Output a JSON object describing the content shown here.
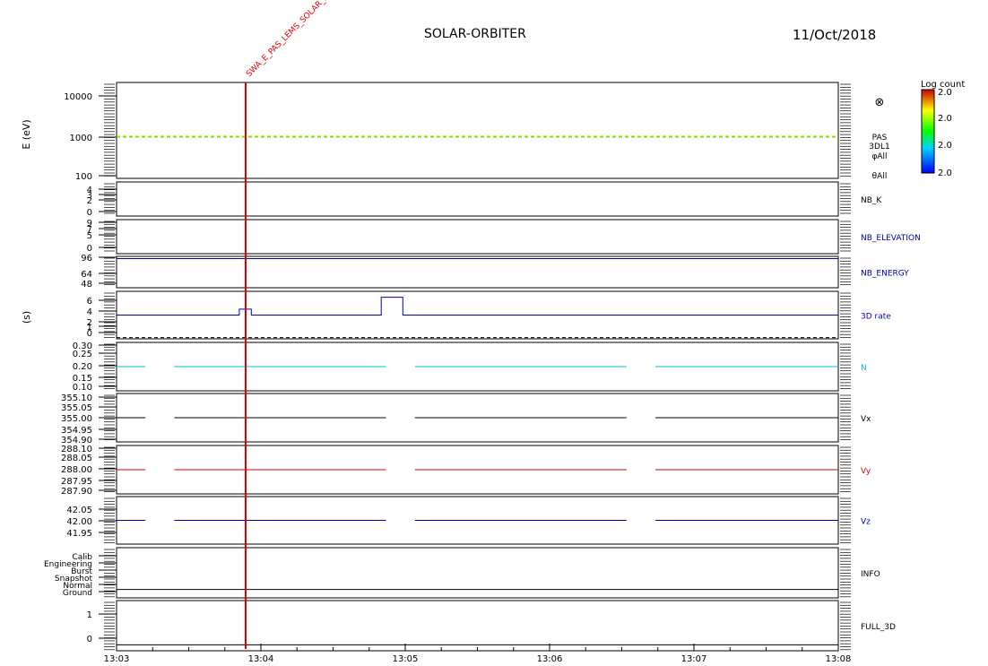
{
  "header": {
    "mission": "SOLAR-ORBITER",
    "date": "11/Oct/2018"
  },
  "marker": {
    "label": "SWA_E_PAS_LEMS_SOLAR_SOI",
    "time": "13:03:53",
    "color": "#e00000"
  },
  "colorbar": {
    "title": "Log count",
    "ticks": [
      "2.0",
      "2.0",
      "2.0",
      "2.0"
    ]
  },
  "side_labels": {
    "energy": "E (eV)",
    "seconds": "(s)"
  },
  "chart_data": {
    "type": "line",
    "x_range": [
      "13:03",
      "13:08"
    ],
    "x_ticks": [
      "13:03",
      "13:04",
      "13:05",
      "13:06",
      "13:07",
      "13:08"
    ],
    "panels": [
      {
        "id": "spectrogram",
        "title_lines": [
          "PAS",
          "3DL1",
          "φAll",
          "",
          "θAll"
        ],
        "symbol": "⊗",
        "ylog": true,
        "ylim": [
          100,
          20000
        ],
        "y_ticks": [
          "10000",
          "1000",
          "100"
        ],
        "series": [
          {
            "style": "dashed",
            "color": "#88dd00",
            "segments": [
              [
                0,
                300,
                1000
              ]
            ]
          }
        ]
      },
      {
        "id": "nb_k",
        "label": "NB_K",
        "label_color": "#000000",
        "ylim": [
          0,
          5
        ],
        "y_ticks": [
          "4",
          "3",
          "2",
          "0"
        ],
        "series": []
      },
      {
        "id": "nb_elevation",
        "label": "NB_ELEVATION",
        "label_color": "#0000aa",
        "ylim": [
          0,
          10
        ],
        "y_ticks": [
          "9",
          "7",
          "5",
          "0"
        ],
        "series": []
      },
      {
        "id": "nb_energy",
        "label": "NB_ENERGY",
        "label_color": "#0000aa",
        "ylim": [
          44,
          100
        ],
        "y_ticks": [
          "96",
          "64",
          "48"
        ],
        "series": [
          {
            "style": "solid",
            "color": "#0000aa",
            "segments": [
              [
                0,
                300,
                96
              ]
            ]
          }
        ]
      },
      {
        "id": "3d_rate",
        "label": "3D rate",
        "label_color": "#0000aa",
        "ylim": [
          0,
          8
        ],
        "y_ticks": [
          "6",
          "4",
          "2",
          "1",
          "0"
        ],
        "series": [
          {
            "style": "step",
            "color": "#0000aa",
            "points": [
              [
                0,
                4
              ],
              [
                51,
                4
              ],
              [
                51,
                5
              ],
              [
                56,
                5
              ],
              [
                56,
                4
              ],
              [
                110,
                4
              ],
              [
                110,
                7
              ],
              [
                119,
                7
              ],
              [
                119,
                4
              ],
              [
                300,
                4
              ]
            ]
          },
          {
            "style": "dashed",
            "color": "#000000",
            "segments": [
              [
                0,
                300,
                0.2
              ]
            ]
          }
        ]
      },
      {
        "id": "n",
        "label": "N",
        "label_color": "#00bbdd",
        "ylim": [
          0.08,
          0.32
        ],
        "y_ticks": [
          "0.30",
          "0.25",
          "0.20",
          "0.15",
          "0.10"
        ],
        "series": [
          {
            "style": "solid",
            "color": "#00bbdd",
            "segments": [
              [
                0,
                12,
                0.2
              ],
              [
                24,
                112,
                0.2
              ],
              [
                124,
                212,
                0.2
              ],
              [
                224,
                300,
                0.2
              ]
            ]
          }
        ]
      },
      {
        "id": "vx",
        "label": "Vx",
        "label_color": "#000000",
        "ylim": [
          354.88,
          355.12
        ],
        "y_ticks": [
          "355.10",
          "355.05",
          "355.00",
          "354.95",
          "354.90"
        ],
        "series": [
          {
            "style": "solid",
            "color": "#000000",
            "segments": [
              [
                0,
                12,
                355.0
              ],
              [
                24,
                112,
                355.0
              ],
              [
                124,
                212,
                355.0
              ],
              [
                224,
                300,
                355.0
              ]
            ]
          }
        ]
      },
      {
        "id": "vy",
        "label": "Vy",
        "label_color": "#dd0000",
        "ylim": [
          287.88,
          288.12
        ],
        "y_ticks": [
          "288.10",
          "288.05",
          "288.00",
          "287.95",
          "287.90"
        ],
        "series": [
          {
            "style": "solid",
            "color": "#dd0000",
            "segments": [
              [
                0,
                12,
                288.0
              ],
              [
                24,
                112,
                288.0
              ],
              [
                124,
                212,
                288.0
              ],
              [
                224,
                300,
                288.0
              ]
            ]
          }
        ]
      },
      {
        "id": "vz",
        "label": "Vz",
        "label_color": "#0000aa",
        "ylim": [
          41.9,
          42.1
        ],
        "y_ticks": [
          "42.05",
          "42.00",
          "41.95"
        ],
        "series": [
          {
            "style": "solid",
            "color": "#0000aa",
            "segments": [
              [
                0,
                12,
                42.0
              ],
              [
                24,
                112,
                42.0
              ],
              [
                124,
                212,
                42.0
              ],
              [
                224,
                300,
                42.0
              ]
            ]
          }
        ]
      },
      {
        "id": "info",
        "label": "INFO",
        "label_color": "#000000",
        "ylim": [
          0,
          6
        ],
        "y_ticks": [
          "Calib",
          "Engineering",
          "Burst",
          "Snapshot",
          "Normal",
          "Ground"
        ],
        "series": [
          {
            "style": "solid",
            "color": "#000000",
            "segments": [
              [
                0,
                300,
                1
              ]
            ]
          }
        ]
      },
      {
        "id": "full_3d",
        "label": "FULL_3D",
        "label_color": "#000000",
        "ylim": [
          -0.2,
          1.5
        ],
        "y_ticks": [
          "1",
          "0"
        ],
        "series": [
          {
            "style": "solid",
            "color": "#000000",
            "segments": [
              [
                0,
                300,
                0
              ]
            ]
          }
        ]
      }
    ]
  }
}
